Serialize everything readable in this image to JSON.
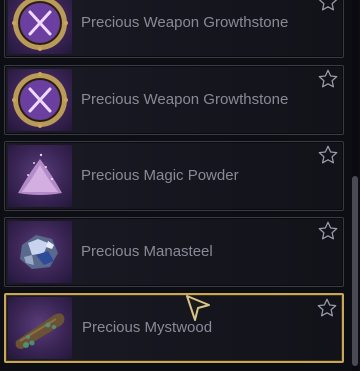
{
  "items": [
    {
      "name": "Precious Weapon Growthstone",
      "icon": "weapon-growthstone-icon",
      "favorite": false
    },
    {
      "name": "Precious Weapon Growthstone",
      "icon": "weapon-growthstone-icon",
      "favorite": false
    },
    {
      "name": "Precious Magic Powder",
      "icon": "magic-powder-icon",
      "favorite": false
    },
    {
      "name": "Precious Manasteel",
      "icon": "manasteel-icon",
      "favorite": false
    },
    {
      "name": "Precious Mystwood",
      "icon": "mystwood-icon",
      "favorite": false,
      "selected": true
    }
  ],
  "colors": {
    "selected_border": "#c9a75a",
    "text": "#8a8a96",
    "icon_background": "#3a2555"
  }
}
